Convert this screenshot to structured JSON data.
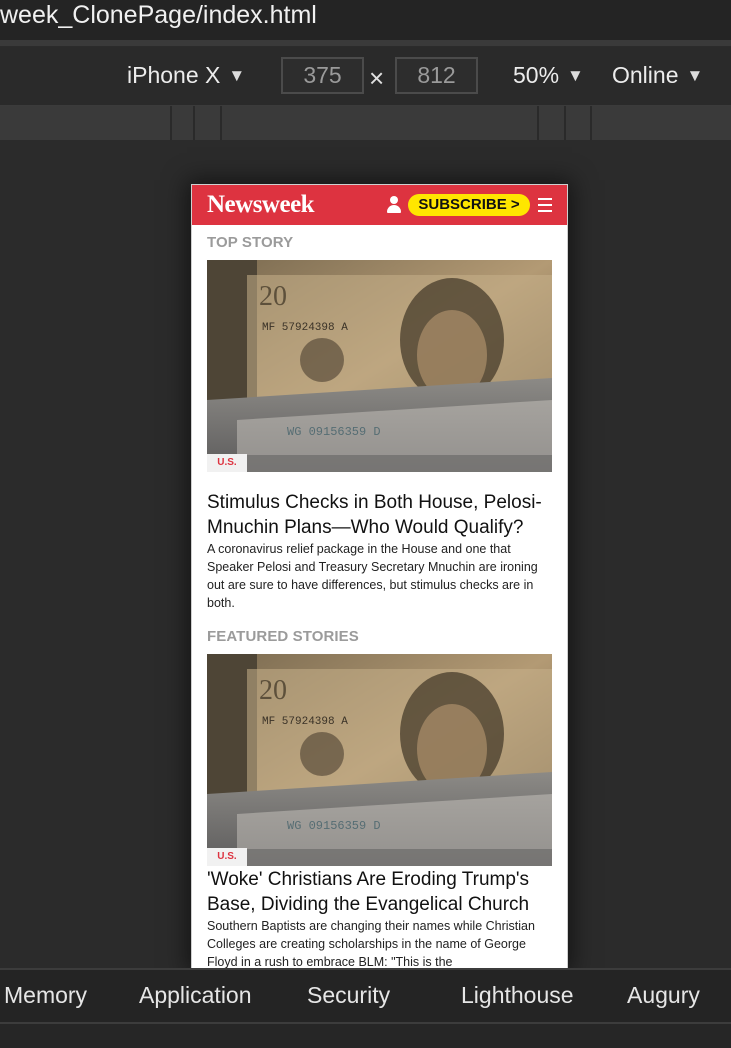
{
  "window": {
    "title": "week_ClonePage/index.html"
  },
  "device_toolbar": {
    "device": "iPhone X",
    "width": "375",
    "height": "812",
    "times": "×",
    "zoom": "50%",
    "throttle": "Online",
    "caret": "▼"
  },
  "page": {
    "logo": "Newsweek",
    "subscribe_label": "SUBSCRIBE >",
    "top_story_label": "TOP STORY",
    "featured_label": "FEATURED STORIES",
    "articles": [
      {
        "tag": "U.S.",
        "headline": "Stimulus Checks in Both House, Pelosi-Mnuchin Plans—Who Would Qualify?",
        "summary": "A coronavirus relief package in the House and one that Speaker Pelosi and Treasury Secretary Mnuchin are ironing out are sure to have differences, but stimulus checks are in both."
      },
      {
        "tag": "U.S.",
        "headline": "'Woke' Christians Are Eroding Trump's Base, Dividing the Evangelical Church",
        "summary": "Southern Baptists are changing their names while Christian Colleges are creating scholarships in the name of George Floyd in a rush to embrace BLM: \"This is the"
      }
    ]
  },
  "devtools_tabs": [
    "Memory",
    "Application",
    "Security",
    "Lighthouse",
    "Augury"
  ],
  "colors": {
    "brand_red": "#dd3340",
    "subscribe_yellow": "#ffe600",
    "devtools_bg": "#2b2b2b"
  }
}
